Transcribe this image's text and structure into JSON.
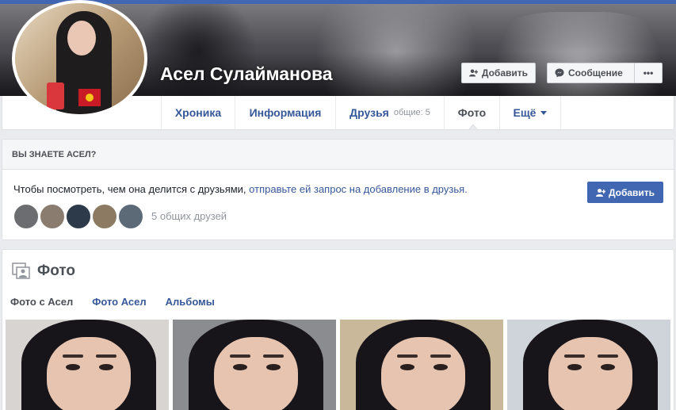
{
  "profile": {
    "name": "Асел Сулайманова",
    "add_label": "Добавить",
    "message_label": "Сообщение",
    "more_label": "•••"
  },
  "nav": {
    "tabs": [
      {
        "label": "Хроника"
      },
      {
        "label": "Информация"
      },
      {
        "label": "Друзья",
        "count": "общие: 5"
      },
      {
        "label": "Фото"
      },
      {
        "label": "Ещё"
      }
    ]
  },
  "know_card": {
    "heading": "ВЫ ЗНАЕТЕ АСЕЛ?",
    "text": "Чтобы посмотреть, чем она делится с друзьями, ",
    "link": "отправьте ей запрос на добавление в друзья.",
    "button": "Добавить",
    "mutual_text": "5 общих друзей",
    "friend_colors": [
      "#6b6d70",
      "#8a7d70",
      "#2c3a4a",
      "#8c7b62",
      "#5c6a78"
    ]
  },
  "photos_card": {
    "title": "Фото",
    "tabs": [
      {
        "label": "Фото с Асел"
      },
      {
        "label": "Фото Асел"
      },
      {
        "label": "Альбомы"
      }
    ],
    "photo_bg": [
      "#d8d4d2",
      "#8a8c90",
      "#c9b89a",
      "#cfd3da"
    ]
  },
  "colors": {
    "brand": "#4267b2",
    "link": "#365899"
  }
}
